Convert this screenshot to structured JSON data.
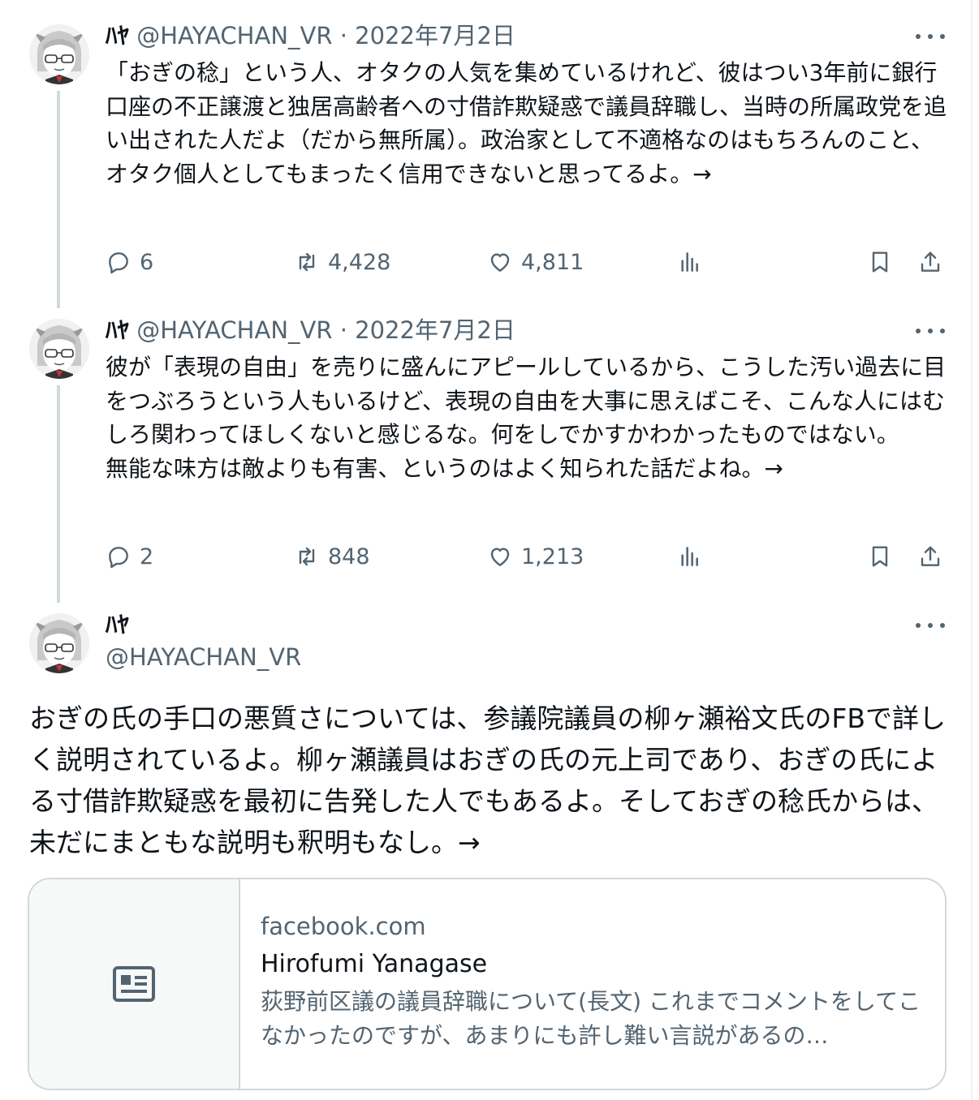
{
  "tweets": [
    {
      "name": "ﾊﾔ",
      "handle": "@HAYACHAN_VR",
      "date": "2022年7月2日",
      "text": "「おぎの稔」という人、オタクの人気を集めているけれど、彼はつい3年前に銀行口座の不正譲渡と独居高齢者への寸借詐欺疑惑で議員辞職し、当時の所属政党を追い出された人だよ（だから無所属）。政治家として不適格なのはもちろんのこと、オタク個人としてもまったく信用できないと思ってるよ。→",
      "replies": "6",
      "reposts": "4,428",
      "likes": "4,811"
    },
    {
      "name": "ﾊﾔ",
      "handle": "@HAYACHAN_VR",
      "date": "2022年7月2日",
      "text": "彼が「表現の自由」を売りに盛んにアピールしているから、こうした汚い過去に目をつぶろうという人もいるけど、表現の自由を大事に思えばこそ、こんな人にはむしろ関わってほしくないと感じるな。何をしでかすかわかったものではない。\n無能な味方は敵よりも有害、というのはよく知られた話だよね。→",
      "replies": "2",
      "reposts": "848",
      "likes": "1,213"
    }
  ],
  "main_tweet": {
    "name": "ﾊﾔ",
    "handle": "@HAYACHAN_VR",
    "text": "おぎの氏の手口の悪質さについては、参議院議員の柳ヶ瀬裕文氏のFBで詳しく説明されているよ。柳ヶ瀬議員はおぎの氏の元上司であり、おぎの氏による寸借詐欺疑惑を最初に告発した人でもあるよ。そしておぎの稔氏からは、未だにまともな説明も釈明もなし。→"
  },
  "link_card": {
    "domain": "facebook.com",
    "title": "Hirofumi Yanagase",
    "description": "荻野前区議の議員辞職について(長文) これまでコメントをしてこなかったのですが、あまりにも許し難い言説があるの…"
  },
  "icons": {
    "reply": "reply-icon",
    "repost": "repost-icon",
    "like": "like-icon",
    "views": "views-icon",
    "bookmark": "bookmark-icon",
    "share": "share-icon",
    "more": "more-icon",
    "article": "article-icon"
  },
  "colors": {
    "text": "#0f1419",
    "secondary": "#536471",
    "border": "#cfd9de",
    "thread_line": "#cfd9de"
  }
}
